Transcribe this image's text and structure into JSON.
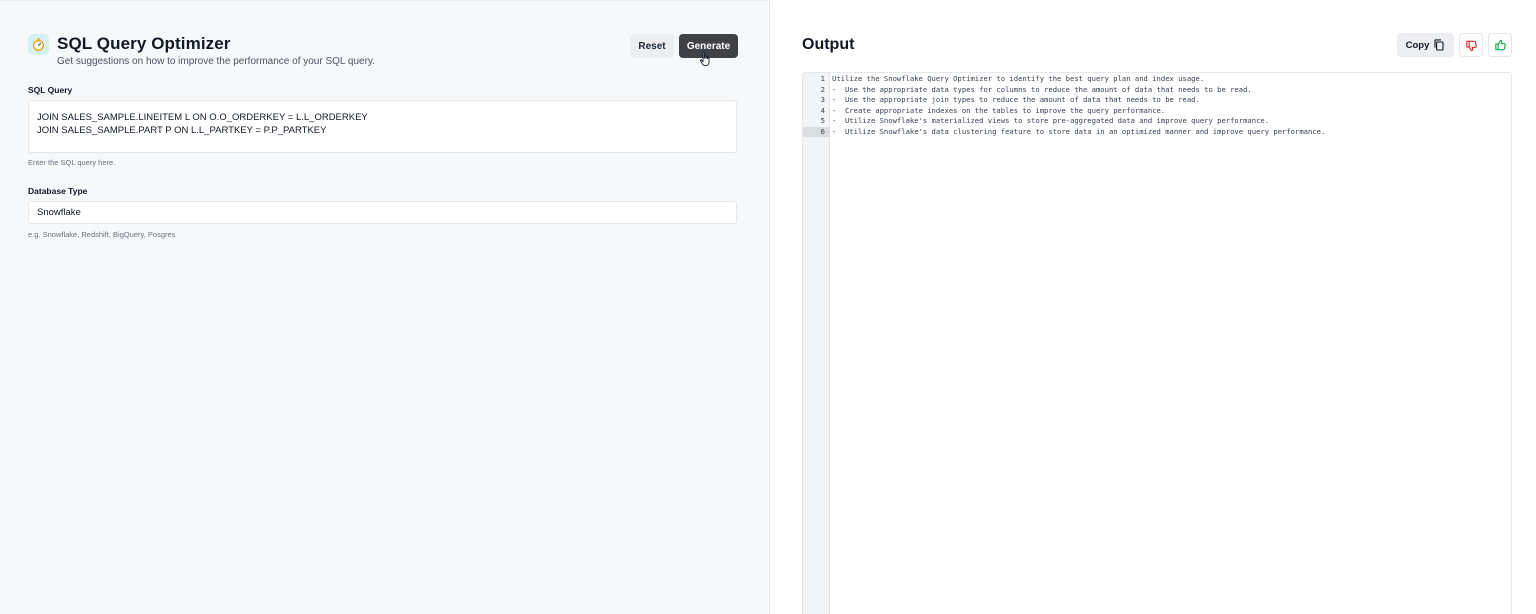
{
  "app": {
    "title": "SQL Query Optimizer",
    "subtitle": "Get suggestions on how to improve the performance of your SQL query.",
    "reset_label": "Reset",
    "generate_label": "Generate"
  },
  "sql_query": {
    "label": "SQL Query",
    "lines": [
      "JOIN SALES_SAMPLE.LINEITEM L ON O.O_ORDERKEY = L.L_ORDERKEY",
      "JOIN SALES_SAMPLE.PART P ON L.L_PARTKEY = P.P_PARTKEY"
    ],
    "helper": "Enter the SQL query here."
  },
  "database_type": {
    "label": "Database Type",
    "value": "Snowflake",
    "helper": "e.g. Snowflake, Redshift, BigQuery, Posgres"
  },
  "output": {
    "title": "Output",
    "copy_label": "Copy",
    "lines": [
      "Utilize the Snowflake Query Optimizer to identify the best query plan and index usage.",
      "-  Use the appropriate data types for columns to reduce the amount of data that needs to be read.",
      "-  Use the appropriate join types to reduce the amount of data that needs to be read.",
      "-  Create appropriate indexes on the tables to improve the query performance.",
      "-  Utilize Snowflake's materialized views to store pre-aggregated data and improve query performance.",
      "-  Utilize Snowflake's data clustering feature to store data in an optimized manner and improve query performance."
    ],
    "line_numbers": [
      "1",
      "2",
      "3",
      "4",
      "5",
      "6"
    ],
    "active_line": "6"
  },
  "icons": {
    "app": "stopwatch-icon",
    "copy": "copy-icon",
    "thumbs_down": "thumbs-down-icon",
    "thumbs_up": "thumbs-up-icon",
    "cursor": "hand-cursor-icon"
  },
  "colors": {
    "thumbs_down": "#dc2626",
    "thumbs_up": "#16a34a",
    "generate_bg": "#3f4147",
    "app_icon_bg": "#d4f1f4"
  }
}
